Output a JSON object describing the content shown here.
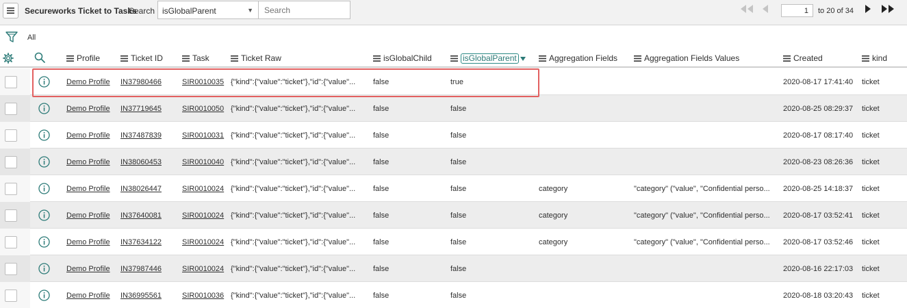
{
  "toolbar": {
    "title": "Secureworks Ticket to Tasks",
    "search_label": "Search",
    "search_field": "isGlobalParent",
    "search_placeholder": "Search",
    "page_value": "1",
    "page_range": "to 20 of 34"
  },
  "filter": {
    "label": "All"
  },
  "columns": [
    {
      "key": "profile",
      "label": "Profile"
    },
    {
      "key": "ticket_id",
      "label": "Ticket ID"
    },
    {
      "key": "task",
      "label": "Task"
    },
    {
      "key": "ticket_raw",
      "label": "Ticket Raw"
    },
    {
      "key": "is_global_child",
      "label": "isGlobalChild"
    },
    {
      "key": "is_global_parent",
      "label": "isGlobalParent"
    },
    {
      "key": "aggregation_fields",
      "label": "Aggregation Fields"
    },
    {
      "key": "aggregation_fields_values",
      "label": "Aggregation Fields Values"
    },
    {
      "key": "created",
      "label": "Created"
    },
    {
      "key": "kind",
      "label": "kind"
    }
  ],
  "rows": [
    {
      "profile": "Demo Profile",
      "ticket_id": "IN37980466",
      "task": "SIR0010035",
      "ticket_raw": "{\"kind\":{\"value\":\"ticket\"},\"id\":{\"value\"...",
      "is_global_child": "false",
      "is_global_parent": "true",
      "aggregation_fields": "",
      "aggregation_fields_values": "",
      "created": "2020-08-17 17:41:40",
      "kind": "ticket"
    },
    {
      "profile": "Demo Profile",
      "ticket_id": "IN37719645",
      "task": "SIR0010050",
      "ticket_raw": "{\"kind\":{\"value\":\"ticket\"},\"id\":{\"value\"...",
      "is_global_child": "false",
      "is_global_parent": "false",
      "aggregation_fields": "",
      "aggregation_fields_values": "",
      "created": "2020-08-25 08:29:37",
      "kind": "ticket"
    },
    {
      "profile": "Demo Profile",
      "ticket_id": "IN37487839",
      "task": "SIR0010031",
      "ticket_raw": "{\"kind\":{\"value\":\"ticket\"},\"id\":{\"value\"...",
      "is_global_child": "false",
      "is_global_parent": "false",
      "aggregation_fields": "",
      "aggregation_fields_values": "",
      "created": "2020-08-17 08:17:40",
      "kind": "ticket"
    },
    {
      "profile": "Demo Profile",
      "ticket_id": "IN38060453",
      "task": "SIR0010040",
      "ticket_raw": "{\"kind\":{\"value\":\"ticket\"},\"id\":{\"value\"...",
      "is_global_child": "false",
      "is_global_parent": "false",
      "aggregation_fields": "",
      "aggregation_fields_values": "",
      "created": "2020-08-23 08:26:36",
      "kind": "ticket"
    },
    {
      "profile": "Demo Profile",
      "ticket_id": "IN38026447",
      "task": "SIR0010024",
      "ticket_raw": "{\"kind\":{\"value\":\"ticket\"},\"id\":{\"value\"...",
      "is_global_child": "false",
      "is_global_parent": "false",
      "aggregation_fields": "category",
      "aggregation_fields_values": "\"category\" (\"value\", \"Confidential perso...",
      "created": "2020-08-25 14:18:37",
      "kind": "ticket"
    },
    {
      "profile": "Demo Profile",
      "ticket_id": "IN37640081",
      "task": "SIR0010024",
      "ticket_raw": "{\"kind\":{\"value\":\"ticket\"},\"id\":{\"value\"...",
      "is_global_child": "false",
      "is_global_parent": "false",
      "aggregation_fields": "category",
      "aggregation_fields_values": "\"category\" (\"value\", \"Confidential perso...",
      "created": "2020-08-17 03:52:41",
      "kind": "ticket"
    },
    {
      "profile": "Demo Profile",
      "ticket_id": "IN37634122",
      "task": "SIR0010024",
      "ticket_raw": "{\"kind\":{\"value\":\"ticket\"},\"id\":{\"value\"...",
      "is_global_child": "false",
      "is_global_parent": "false",
      "aggregation_fields": "category",
      "aggregation_fields_values": "\"category\" (\"value\", \"Confidential perso...",
      "created": "2020-08-17 03:52:46",
      "kind": "ticket"
    },
    {
      "profile": "Demo Profile",
      "ticket_id": "IN37987446",
      "task": "SIR0010024",
      "ticket_raw": "{\"kind\":{\"value\":\"ticket\"},\"id\":{\"value\"...",
      "is_global_child": "false",
      "is_global_parent": "false",
      "aggregation_fields": "",
      "aggregation_fields_values": "",
      "created": "2020-08-16 22:17:03",
      "kind": "ticket"
    },
    {
      "profile": "Demo Profile",
      "ticket_id": "IN36995561",
      "task": "SIR0010036",
      "ticket_raw": "{\"kind\":{\"value\":\"ticket\"},\"id\":{\"value\"...",
      "is_global_child": "false",
      "is_global_parent": "false",
      "aggregation_fields": "",
      "aggregation_fields_values": "",
      "created": "2020-08-18 03:20:43",
      "kind": "ticket"
    }
  ],
  "sorted_column": "is_global_parent",
  "highlighted_row": 0,
  "colors": {
    "accent": "#2b7a77",
    "highlight": "#e26060",
    "alt_row": "#ededed"
  }
}
